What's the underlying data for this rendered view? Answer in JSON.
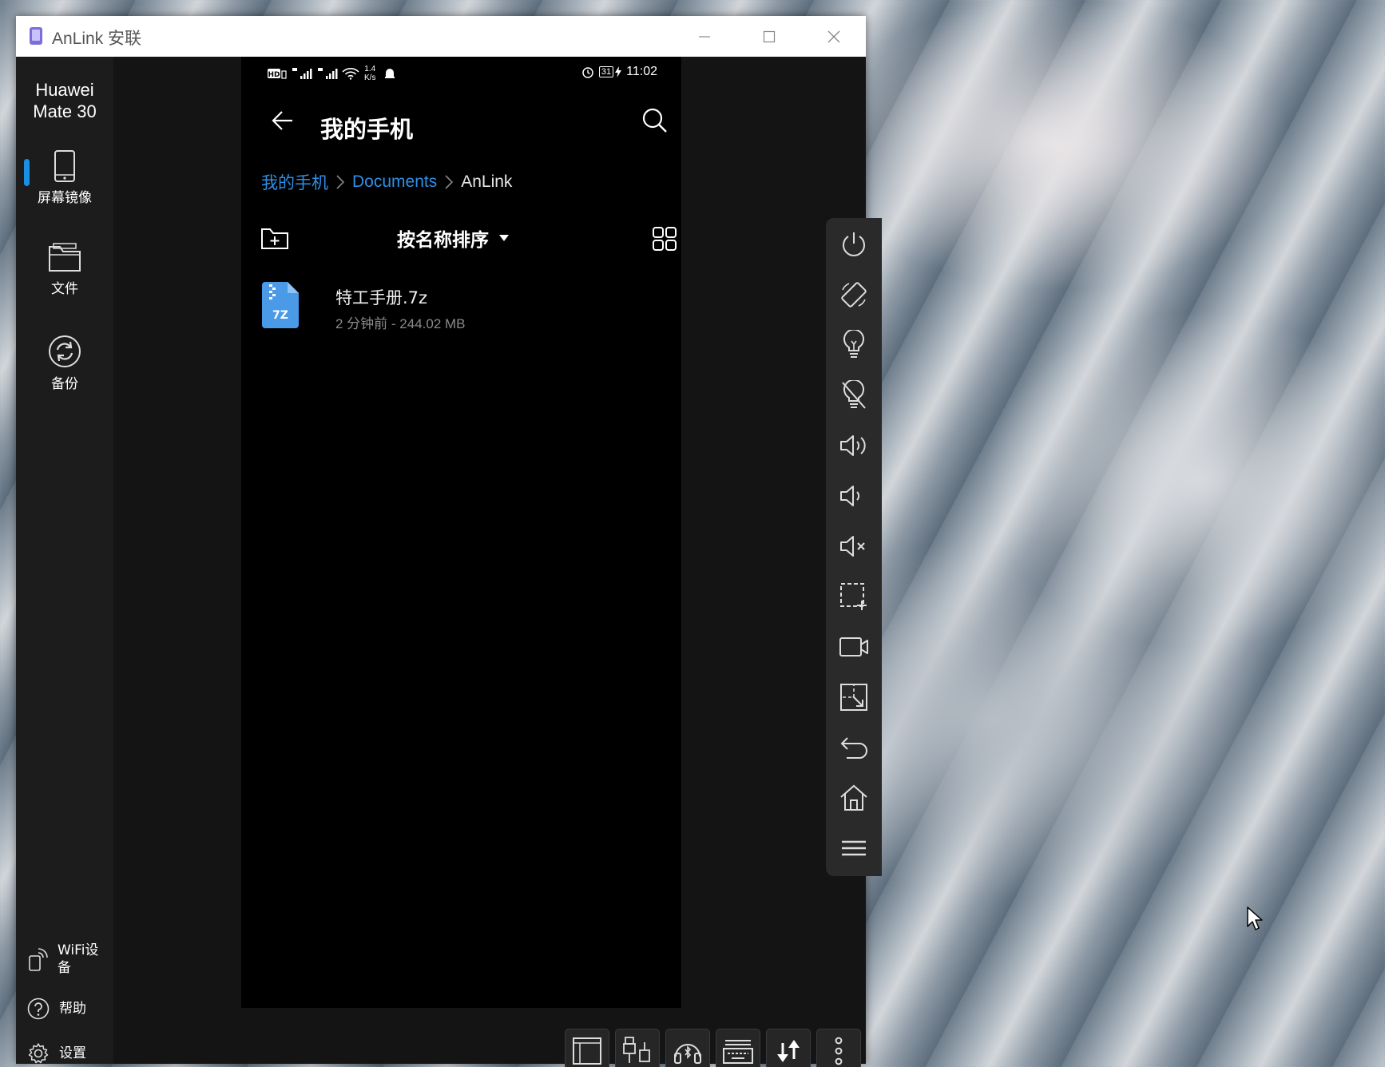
{
  "window": {
    "title": "AnLink 安联",
    "controls": [
      "minimize-icon",
      "maximize-icon",
      "close-icon"
    ]
  },
  "sidebar": {
    "device_name_line1": "Huawei",
    "device_name_line2": "Mate 30",
    "items": [
      {
        "label": "屏幕镜像",
        "icon": "phone-icon",
        "active": true
      },
      {
        "label": "文件",
        "icon": "folder-icon",
        "active": false
      },
      {
        "label": "备份",
        "icon": "sync-icon",
        "active": false
      }
    ],
    "bottom_items": [
      {
        "label_line1": "WiFi设",
        "label_line2": "备",
        "icon": "wifi-device-icon"
      },
      {
        "label": "帮助",
        "icon": "help-icon"
      },
      {
        "label": "设置",
        "icon": "gear-icon"
      }
    ],
    "accent_color": "#1a8fe3"
  },
  "phone": {
    "status": {
      "speed_value": "1.4",
      "speed_unit": "K/s",
      "battery": "31",
      "time": "11:02"
    },
    "header_title": "我的手机",
    "breadcrumb": {
      "items": [
        "我的手机",
        "Documents"
      ],
      "current": "AnLink"
    },
    "sort_label": "按名称排序",
    "files": [
      {
        "name": "特工手册.7z",
        "meta": "2 分钟前 - 244.02 MB",
        "badge": "7Z"
      }
    ],
    "link_color": "#2e8fe6"
  },
  "right_toolbar": [
    "power-icon",
    "rotate-icon",
    "light-on-icon",
    "light-off-icon",
    "volume-up-icon",
    "volume-down-icon",
    "mute-icon",
    "screenshot-icon",
    "record-icon",
    "crop-icon",
    "back-icon",
    "home-icon",
    "menu-icon"
  ],
  "bottom_toolbar": [
    "layout-icon",
    "usb-icon",
    "headset-icon",
    "keyboard-icon",
    "transfer-icon",
    "more-icon"
  ]
}
